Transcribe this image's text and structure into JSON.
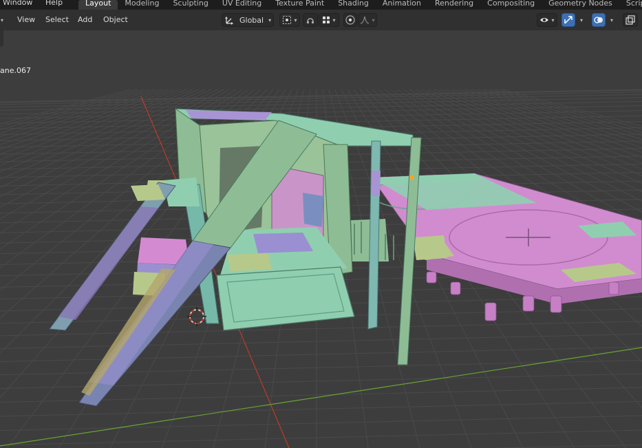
{
  "topbar": {
    "menus": [
      "Window",
      "Help"
    ],
    "tabs": [
      "Layout",
      "Modeling",
      "Sculpting",
      "UV Editing",
      "Texture Paint",
      "Shading",
      "Animation",
      "Rendering",
      "Compositing",
      "Geometry Nodes",
      "Scripting"
    ],
    "active_tab": "Layout"
  },
  "header": {
    "menus": [
      "View",
      "Select",
      "Add",
      "Object"
    ],
    "orientation": "Global"
  },
  "viewport": {
    "object_name": "ane.067",
    "icons": [
      "transform-orientation-icon",
      "pivot-point-icon",
      "snap-icon",
      "snap-target-icon",
      "proportional-edit-icon",
      "falloff-icon",
      "visibility-icon",
      "gizmo-icon",
      "overlay-icon",
      "xray-icon"
    ]
  },
  "colors": {
    "viewport_bg": "#3d3d3d",
    "grid": "#4a4a4a",
    "x_axis": "#c0392b",
    "y_axis": "#6aa533",
    "header_bg": "#303030",
    "topbar_bg": "#1d1d1d",
    "active_button": "#3d6fb3",
    "mesh_green": "#8ebd95",
    "mesh_teal": "#76b9a8",
    "mesh_purple": "#9a8fd1",
    "mesh_pink": "#d48ad1",
    "mesh_olive": "#b6c98a"
  }
}
